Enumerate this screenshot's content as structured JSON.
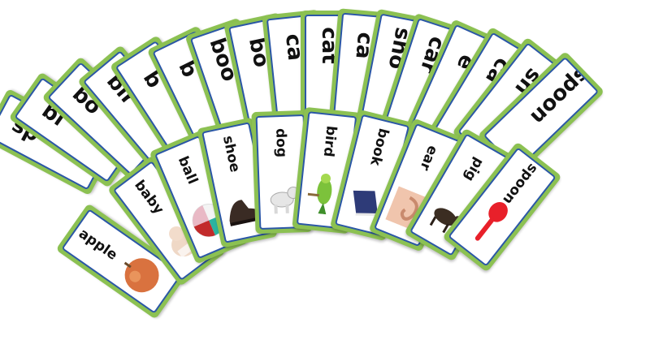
{
  "back_row": [
    {
      "word": "sp",
      "name": "back-card-1"
    },
    {
      "word": "bi",
      "name": "back-card-2"
    },
    {
      "word": "bo",
      "name": "back-card-3"
    },
    {
      "word": "bir",
      "name": "back-card-4"
    },
    {
      "word": "b",
      "name": "back-card-5"
    },
    {
      "word": "b",
      "name": "back-card-6"
    },
    {
      "word": "boo",
      "name": "back-card-7"
    },
    {
      "word": "bo",
      "name": "back-card-8"
    },
    {
      "word": "ca",
      "name": "back-card-9"
    },
    {
      "word": "cat",
      "name": "back-card-10"
    },
    {
      "word": "ca",
      "name": "back-card-11"
    },
    {
      "word": "sho",
      "name": "back-card-12"
    },
    {
      "word": "car",
      "name": "back-card-13"
    },
    {
      "word": "e",
      "name": "back-card-14"
    },
    {
      "word": "ca",
      "name": "back-card-15"
    },
    {
      "word": "sh",
      "name": "back-card-16"
    },
    {
      "word": "spoon",
      "name": "back-card-17"
    }
  ],
  "front_row": [
    {
      "word": "apple",
      "picture": "apple",
      "name": "card-apple"
    },
    {
      "word": "baby",
      "picture": "baby",
      "name": "card-baby"
    },
    {
      "word": "ball",
      "picture": "ball",
      "name": "card-ball"
    },
    {
      "word": "shoe",
      "picture": "shoe",
      "name": "card-shoe"
    },
    {
      "word": "dog",
      "picture": "dog",
      "name": "card-dog"
    },
    {
      "word": "bird",
      "picture": "bird",
      "name": "card-bird"
    },
    {
      "word": "book",
      "picture": "book",
      "name": "card-book"
    },
    {
      "word": "ear",
      "picture": "ear",
      "name": "card-ear"
    },
    {
      "word": "pig",
      "picture": "pig",
      "name": "card-pig"
    },
    {
      "word": "spoon",
      "picture": "spoon",
      "name": "card-spoon"
    }
  ],
  "colors": {
    "card_border": "#8cc152",
    "inner_frame": "#2b57a6",
    "spoon": "#e8202a",
    "apple": "#d9723f",
    "bird": "#7cc23b"
  }
}
